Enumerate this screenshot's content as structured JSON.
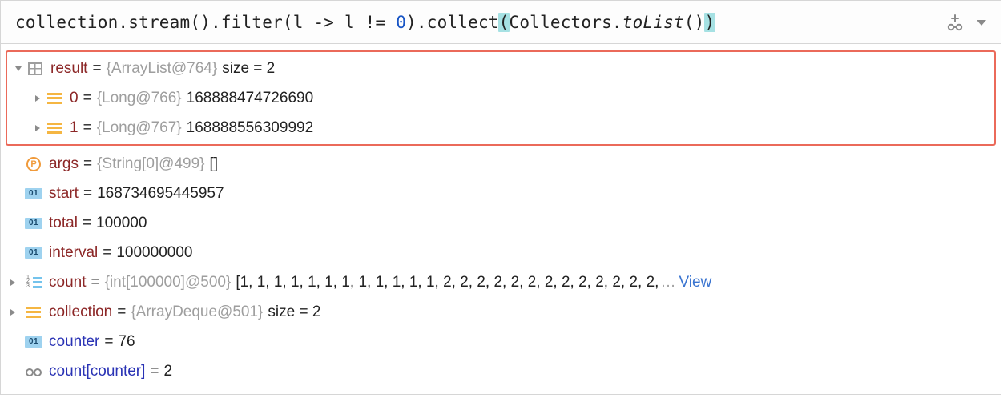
{
  "expression": {
    "pre1": "collection.stream().filter(l -> l != ",
    "zero": "0",
    "post1": ").collect",
    "lparen": "(",
    "colClass": "Collectors.",
    "method": "toList",
    "callEnd": "()",
    "rparen": ")"
  },
  "highlighted": {
    "result": {
      "name": "result",
      "equals": "=",
      "type": "{ArrayList@764}",
      "sizeLabel": "size = 2"
    },
    "items": [
      {
        "idx": "0",
        "equals": "=",
        "type": "{Long@766}",
        "value": "168888474726690"
      },
      {
        "idx": "1",
        "equals": "=",
        "type": "{Long@767}",
        "value": "168888556309992"
      }
    ]
  },
  "vars": {
    "args": {
      "name": "args",
      "equals": "=",
      "type": "{String[0]@499}",
      "value": "[]"
    },
    "start": {
      "name": "start",
      "equals": "=",
      "value": "168734695445957"
    },
    "total": {
      "name": "total",
      "equals": "=",
      "value": "100000"
    },
    "interval": {
      "name": "interval",
      "equals": "=",
      "value": "100000000"
    },
    "count": {
      "name": "count",
      "equals": "=",
      "type": "{int[100000]@500}",
      "value": "[1, 1, 1, 1, 1, 1, 1, 1, 1, 1, 1, 1, 2, 2, 2, 2, 2, 2, 2, 2, 2, 2, 2, 2, 2,",
      "ellipsis": "…",
      "view": "View"
    },
    "collection": {
      "name": "collection",
      "equals": "=",
      "type": "{ArrayDeque@501}",
      "sizeLabel": "size = 2"
    },
    "counter": {
      "name": "counter",
      "equals": "=",
      "value": "76"
    },
    "watch": {
      "name": "count[counter]",
      "equals": "=",
      "value": "2"
    }
  }
}
